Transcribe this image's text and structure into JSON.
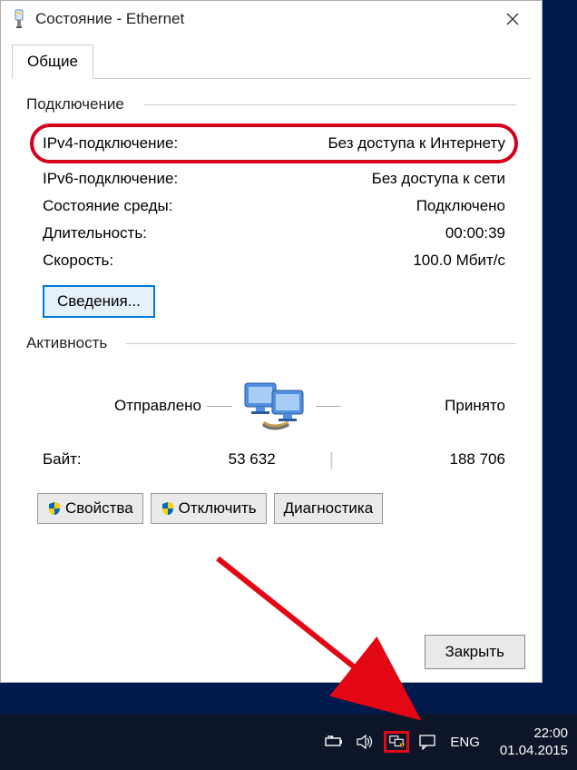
{
  "window": {
    "title": "Состояние - Ethernet"
  },
  "tabs": {
    "general": "Общие"
  },
  "connection": {
    "group_label": "Подключение",
    "ipv4_label": "IPv4-подключение:",
    "ipv4_value": "Без доступа к Интернету",
    "ipv6_label": "IPv6-подключение:",
    "ipv6_value": "Без доступа к сети",
    "media_label": "Состояние среды:",
    "media_value": "Подключено",
    "duration_label": "Длительность:",
    "duration_value": "00:00:39",
    "speed_label": "Скорость:",
    "speed_value": "100.0 Мбит/с",
    "details_btn": "Сведения..."
  },
  "activity": {
    "group_label": "Активность",
    "sent_label": "Отправлено",
    "recv_label": "Принято",
    "bytes_label": "Байт:",
    "sent_value": "53 632",
    "recv_value": "188 706"
  },
  "buttons": {
    "properties": "Свойства",
    "disable": "Отключить",
    "diagnose": "Диагностика",
    "close": "Закрыть"
  },
  "taskbar": {
    "lang": "ENG",
    "time": "22:00",
    "date": "01.04.2015"
  }
}
